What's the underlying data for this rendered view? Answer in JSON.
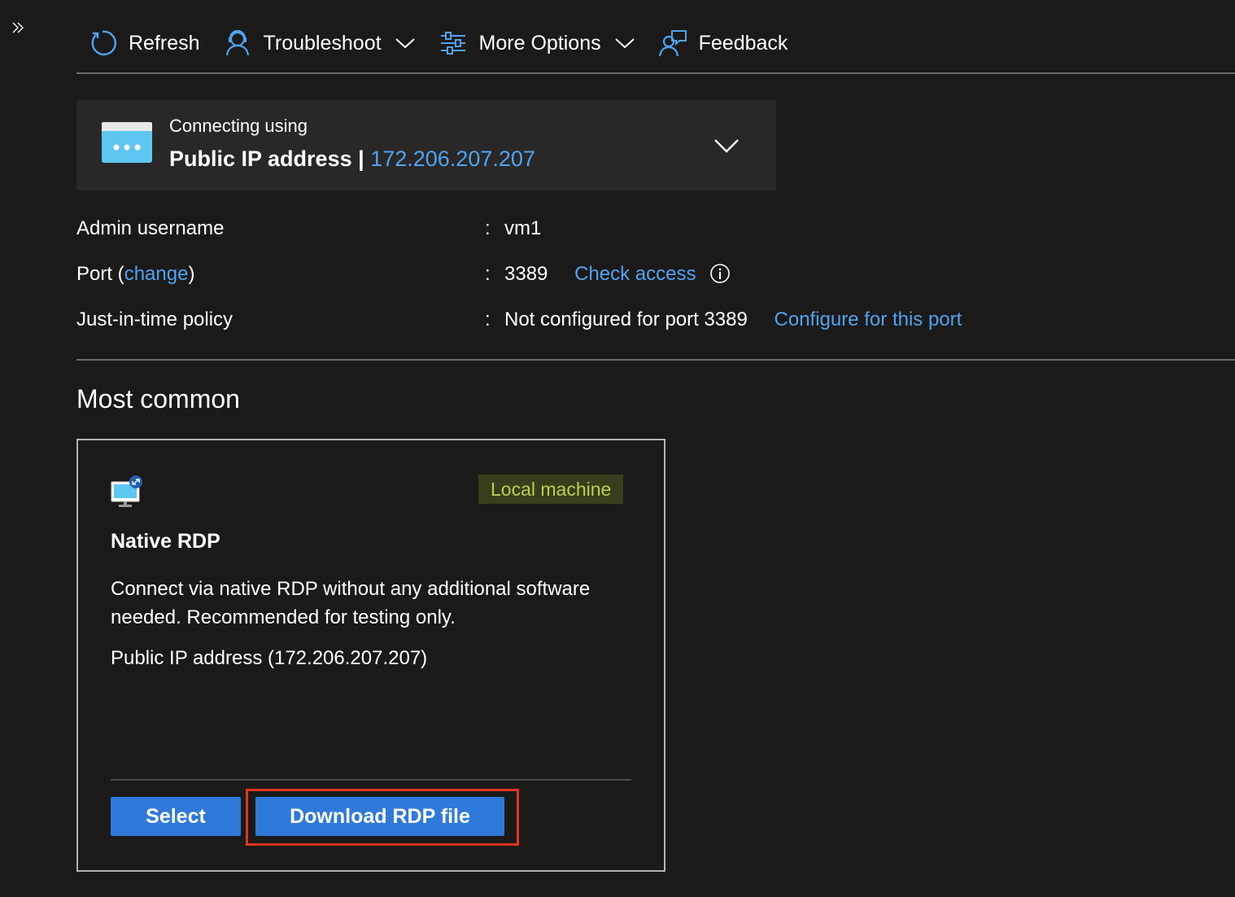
{
  "toolbar": {
    "refresh_label": "Refresh",
    "troubleshoot_label": "Troubleshoot",
    "more_options_label": "More Options",
    "feedback_label": "Feedback"
  },
  "connection": {
    "label": "Connecting using",
    "method": "Public IP address",
    "separator": "|",
    "ip": "172.206.207.207"
  },
  "properties": {
    "admin_username": {
      "key": "Admin username",
      "value": "vm1"
    },
    "port": {
      "key_prefix": "Port (",
      "change_link": "change",
      "key_suffix": ")",
      "value": "3389",
      "check_access_link": "Check access"
    },
    "jit_policy": {
      "key": "Just-in-time policy",
      "value": "Not configured for port 3389",
      "configure_link": "Configure for this port"
    },
    "colon": ":"
  },
  "section": {
    "title": "Most common"
  },
  "rdp_card": {
    "badge": "Local machine",
    "title": "Native RDP",
    "description": "Connect via native RDP without any additional software needed. Recommended for testing only.",
    "ip_line": "Public IP address (172.206.207.207)",
    "select_label": "Select",
    "download_label": "Download RDP file"
  },
  "colors": {
    "background": "#1b1a19",
    "card": "#292827",
    "accent": "#2f79db",
    "link": "#4fa3f2",
    "badge_bg": "#393d1b",
    "badge_text": "#b7d34e",
    "highlight": "#e1341e"
  },
  "icons": [
    "expand-icon",
    "refresh-icon",
    "troubleshoot-icon",
    "chevron-down-icon",
    "more-options-icon",
    "feedback-icon",
    "window-icon",
    "info-icon",
    "monitor-rdp-icon"
  ]
}
